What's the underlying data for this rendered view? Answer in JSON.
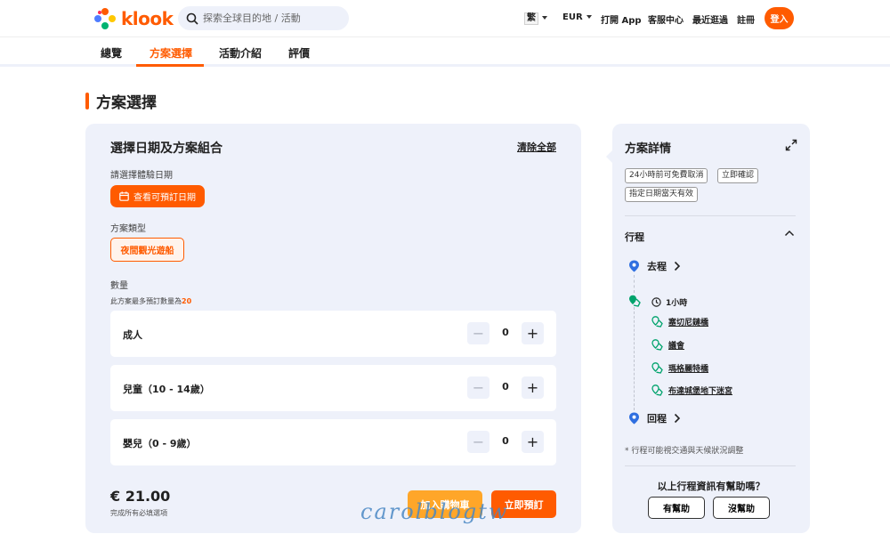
{
  "header": {
    "logo_text": "klook",
    "search_placeholder": "探索全球目的地 / 活動",
    "lang": "繁",
    "currency": "EUR",
    "open_app": "打開 App",
    "help_center": "客服中心",
    "recently_viewed": "最近逛過",
    "signup": "註冊",
    "login": "登入",
    "brand_color": "#ff5b00"
  },
  "tabs": [
    {
      "label": "總覽"
    },
    {
      "label": "方案選擇",
      "active": true
    },
    {
      "label": "活動介紹"
    },
    {
      "label": "評價"
    }
  ],
  "section_title": "方案選擇",
  "booking": {
    "title": "選擇日期及方案組合",
    "clear_all": "清除全部",
    "date_label": "請選擇體驗日期",
    "date_button": "查看可預訂日期",
    "package_type_label": "方案類型",
    "package_option": "夜間觀光遊船",
    "quantity_label": "數量",
    "max_note_prefix": "此方案最多預訂數量為",
    "max_note_value": "20",
    "rows": [
      {
        "label": "成人",
        "value": "0"
      },
      {
        "label": "兒童（10 - 14歲）",
        "value": "0"
      },
      {
        "label": "嬰兒（0 - 9歲）",
        "value": "0"
      }
    ],
    "price": "€ 21.00",
    "price_note": "完成所有必填選項",
    "add_to_cart": "加入購物車",
    "book_now": "立即預訂"
  },
  "watermark": "carolblogtw",
  "details": {
    "title": "方案詳情",
    "tags": [
      "24小時前可免費取消",
      "立即確認",
      "指定日期當天有效"
    ],
    "itinerary_title": "行程",
    "departure": "去程",
    "duration": "1小時",
    "points": [
      "塞切尼鏈橋",
      "議會",
      "瑪格麗特橋",
      "布達城堡地下迷宮"
    ],
    "return": "回程",
    "note": "* 行程可能視交通與天候狀況調整",
    "helpful_question": "以上行程資訊有幫助嗎？",
    "yes": "有幫助",
    "no": "沒幫助"
  }
}
